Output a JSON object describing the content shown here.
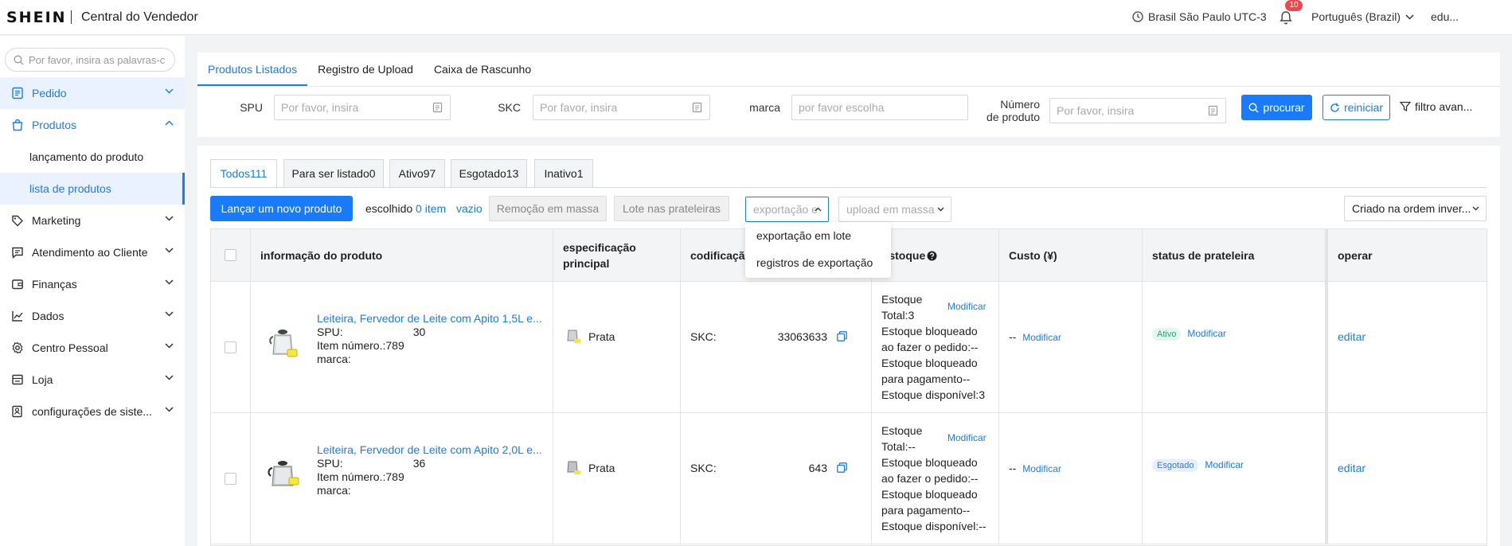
{
  "header": {
    "logo": "SHEIN",
    "subtitle": "Central do Vendedor",
    "timezone": "Brasil São Paulo UTC-3",
    "notifications": "10",
    "language": "Português (Brazil)",
    "user": "edu..."
  },
  "sidebar": {
    "search_placeholder": "Por favor, insira as palavras-c",
    "items": [
      {
        "label": "Pedido"
      },
      {
        "label": "Produtos"
      },
      {
        "label": "lançamento do produto"
      },
      {
        "label": "lista de produtos"
      },
      {
        "label": "Marketing"
      },
      {
        "label": "Atendimento ao Cliente"
      },
      {
        "label": "Finanças"
      },
      {
        "label": "Dados"
      },
      {
        "label": "Centro Pessoal"
      },
      {
        "label": "Loja"
      },
      {
        "label": "configurações de siste..."
      }
    ]
  },
  "top_tabs": [
    "Produtos Listados",
    "Registro de Upload",
    "Caixa de Rascunho"
  ],
  "filters": {
    "spu_label": "SPU",
    "spu_placeholder": "Por favor, insira",
    "skc_label": "SKC",
    "skc_placeholder": "Por favor, insira",
    "marca_label": "marca",
    "marca_placeholder": "por favor escolha",
    "numero_label_1": "Número",
    "numero_label_2": "de produto",
    "numero_placeholder": "Por favor, insira",
    "search_btn": "procurar",
    "reset_btn": "reiniciar",
    "advanced_btn": "filtro avan..."
  },
  "status_tabs": [
    "Todos111",
    "Para ser listado0",
    "Ativo97",
    "Esgotado13",
    "Inativo1"
  ],
  "toolbar": {
    "new_product": "Lançar um novo produto",
    "selected_prefix": "escolhido",
    "selected_count": "0 item",
    "clear": "vazio",
    "bulk_remove": "Remoção em massa",
    "bulk_shelf": "Lote nas prateleiras",
    "export_placeholder": "exportação e",
    "upload_placeholder": "upload em massa",
    "sort": "Criado na ordem inver..."
  },
  "export_menu": [
    "exportação em lote",
    "registros de exportação"
  ],
  "table": {
    "headers": {
      "info": "informação do produto",
      "spec_1": "especificação",
      "spec_2": "principal",
      "coding": "codificação",
      "stock": "Estoque",
      "cost": "Custo (¥)",
      "shelf_status": "status de prateleira",
      "operate": "operar"
    },
    "rows": [
      {
        "title": "Leiteira, Fervedor de Leite com Apito 1,5L e...",
        "spu_label": "SPU:",
        "spu_value": "30",
        "item_label": "Item número.:",
        "item_value": "789",
        "brand_label": "marca:",
        "spec": "Prata",
        "skc_label": "SKC:",
        "skc_value": "33063633",
        "stock_lines": [
          "Estoque",
          "Total:3",
          "Estoque bloqueado",
          "ao fazer o pedido:--",
          "Estoque bloqueado",
          "para pagamento--",
          "Estoque disponível:3"
        ],
        "modify": "Modificar",
        "cost": "--",
        "cost_modify": "Modificar",
        "status": "Ativo",
        "status_modify": "Modificar",
        "action": "editar"
      },
      {
        "title": "Leiteira, Fervedor de Leite com Apito 2,0L e...",
        "spu_label": "SPU:",
        "spu_value": "36",
        "item_label": "Item número.:",
        "item_value": "789",
        "brand_label": "marca:",
        "spec": "Prata",
        "skc_label": "SKC:",
        "skc_value": "643",
        "stock_lines": [
          "Estoque",
          "Total:--",
          "Estoque bloqueado",
          "ao fazer o pedido:--",
          "Estoque bloqueado",
          "para pagamento--",
          "Estoque disponível:--"
        ],
        "modify": "Modificar",
        "cost": "--",
        "cost_modify": "Modificar",
        "status": "Esgotado",
        "status_modify": "Modificar",
        "action": "editar"
      }
    ]
  },
  "colors": {
    "accent": "#197afa",
    "badge": "#f4444b",
    "active_tag": "#23a66d"
  }
}
